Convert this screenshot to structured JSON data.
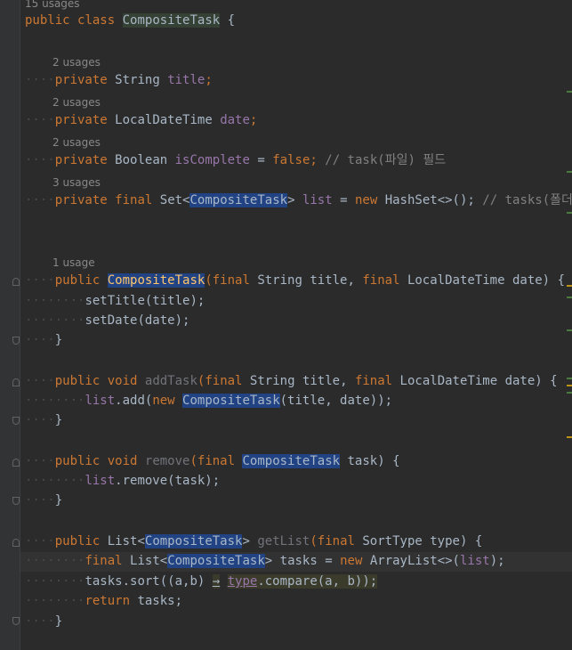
{
  "usage_hints": {
    "class": "15 usages",
    "title": "2 usages",
    "date": "2 usages",
    "isComplete": "2 usages",
    "list": "3 usages",
    "constructor": "1 usage"
  },
  "code": {
    "l_class": [
      "public",
      "class",
      "CompositeTask",
      "{"
    ],
    "title_decl": [
      "private",
      "String",
      "title",
      ";"
    ],
    "date_decl": [
      "private",
      "LocalDateTime",
      "date",
      ";"
    ],
    "complete_decl": [
      "private",
      "Boolean",
      "isComplete",
      "=",
      "false",
      ";",
      "// task(파일) 필드"
    ],
    "list_decl": [
      "private",
      "final",
      "Set<",
      "CompositeTask",
      ">",
      "list",
      "=",
      "new",
      "HashSet<>();",
      "// tasks(폴더) 필"
    ],
    "ctor": [
      "public",
      "CompositeTask",
      "(final",
      "String",
      "title,",
      "final",
      "LocalDateTime",
      "date)",
      "{"
    ],
    "set_title": "setTitle(title);",
    "set_date": "setDate(date);",
    "close": "}",
    "addtask": [
      "public",
      "void",
      "addTask",
      "(final",
      "String",
      "title,",
      "final",
      "LocalDateTime",
      "date)",
      "{"
    ],
    "list_add": [
      "list",
      ".add(",
      "new",
      "CompositeTask",
      "(title, date));"
    ],
    "remove": [
      "public",
      "void",
      "remove",
      "(final",
      "CompositeTask",
      "task)",
      "{"
    ],
    "list_remove": [
      "list",
      ".remove(task);"
    ],
    "getlist": [
      "public",
      "List<",
      "CompositeTask",
      ">",
      "getList",
      "(final",
      "SortType",
      "type)",
      "{"
    ],
    "tasks_decl": [
      "final",
      "List<",
      "CompositeTask",
      ">",
      "tasks",
      "=",
      "new",
      "ArrayList<>(",
      "list",
      ");"
    ],
    "sort": [
      "tasks.sort((a,b)",
      "→",
      "type",
      ".compare(a, b));"
    ],
    "ret": [
      "return",
      "tasks;"
    ]
  },
  "colors": {
    "background": "#2b2b2b",
    "keyword": "#cc7832",
    "field": "#9876aa",
    "comment": "#808080",
    "selection": "#214283"
  }
}
